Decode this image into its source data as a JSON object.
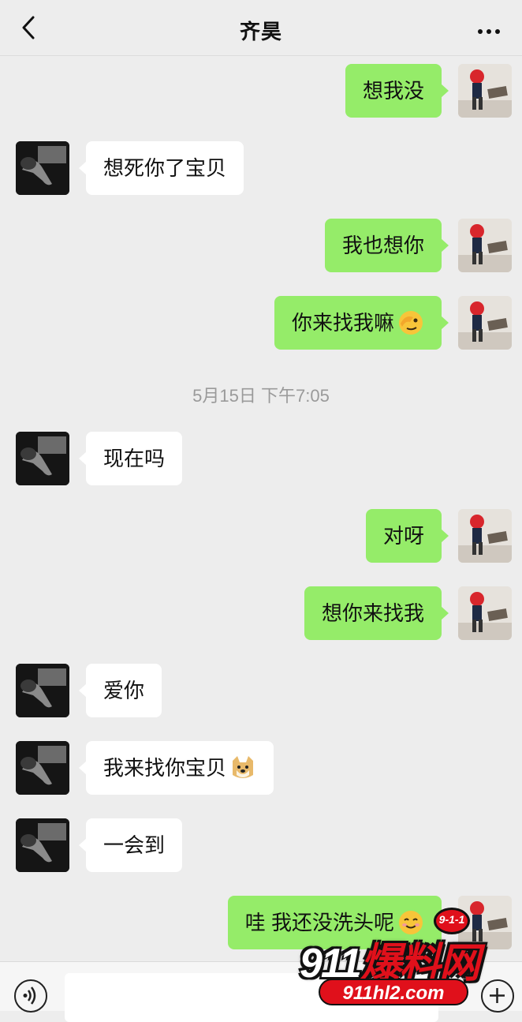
{
  "header": {
    "title": "齐昊",
    "back_icon": "chevron-left-icon",
    "more_icon": "more-dots-icon"
  },
  "messages": [
    {
      "side": "right",
      "text": "想我没"
    },
    {
      "side": "left",
      "text": "想死你了宝贝"
    },
    {
      "side": "right",
      "text": "我也想你"
    },
    {
      "side": "right",
      "text": "你来找我嘛",
      "emoji": "face-with-hand-over-eye-emoji"
    },
    {
      "side": "left",
      "text": "现在吗"
    },
    {
      "side": "right",
      "text": "对呀"
    },
    {
      "side": "right",
      "text": "想你来找我"
    },
    {
      "side": "left",
      "text": "爱你"
    },
    {
      "side": "left",
      "text": "我来找你宝贝",
      "emoji": "doge-emoji"
    },
    {
      "side": "left",
      "text": "一会到"
    },
    {
      "side": "right",
      "text": "哇 我还没洗头呢",
      "emoji": "smiling-face-emoji"
    }
  ],
  "timestamp": "5月15日 下午7:05",
  "input_bar": {
    "voice_icon": "voice-icon",
    "plus_icon": "plus-icon",
    "text_value": ""
  },
  "watermark": {
    "badge": "9-1-1",
    "brand_number": "911",
    "brand_text": "爆料网",
    "url": "911hl2.com"
  },
  "colors": {
    "background": "#ededed",
    "my_bubble": "#95ec69",
    "their_bubble": "#ffffff",
    "timestamp": "#9a9a9a",
    "watermark_red": "#e0101b"
  }
}
